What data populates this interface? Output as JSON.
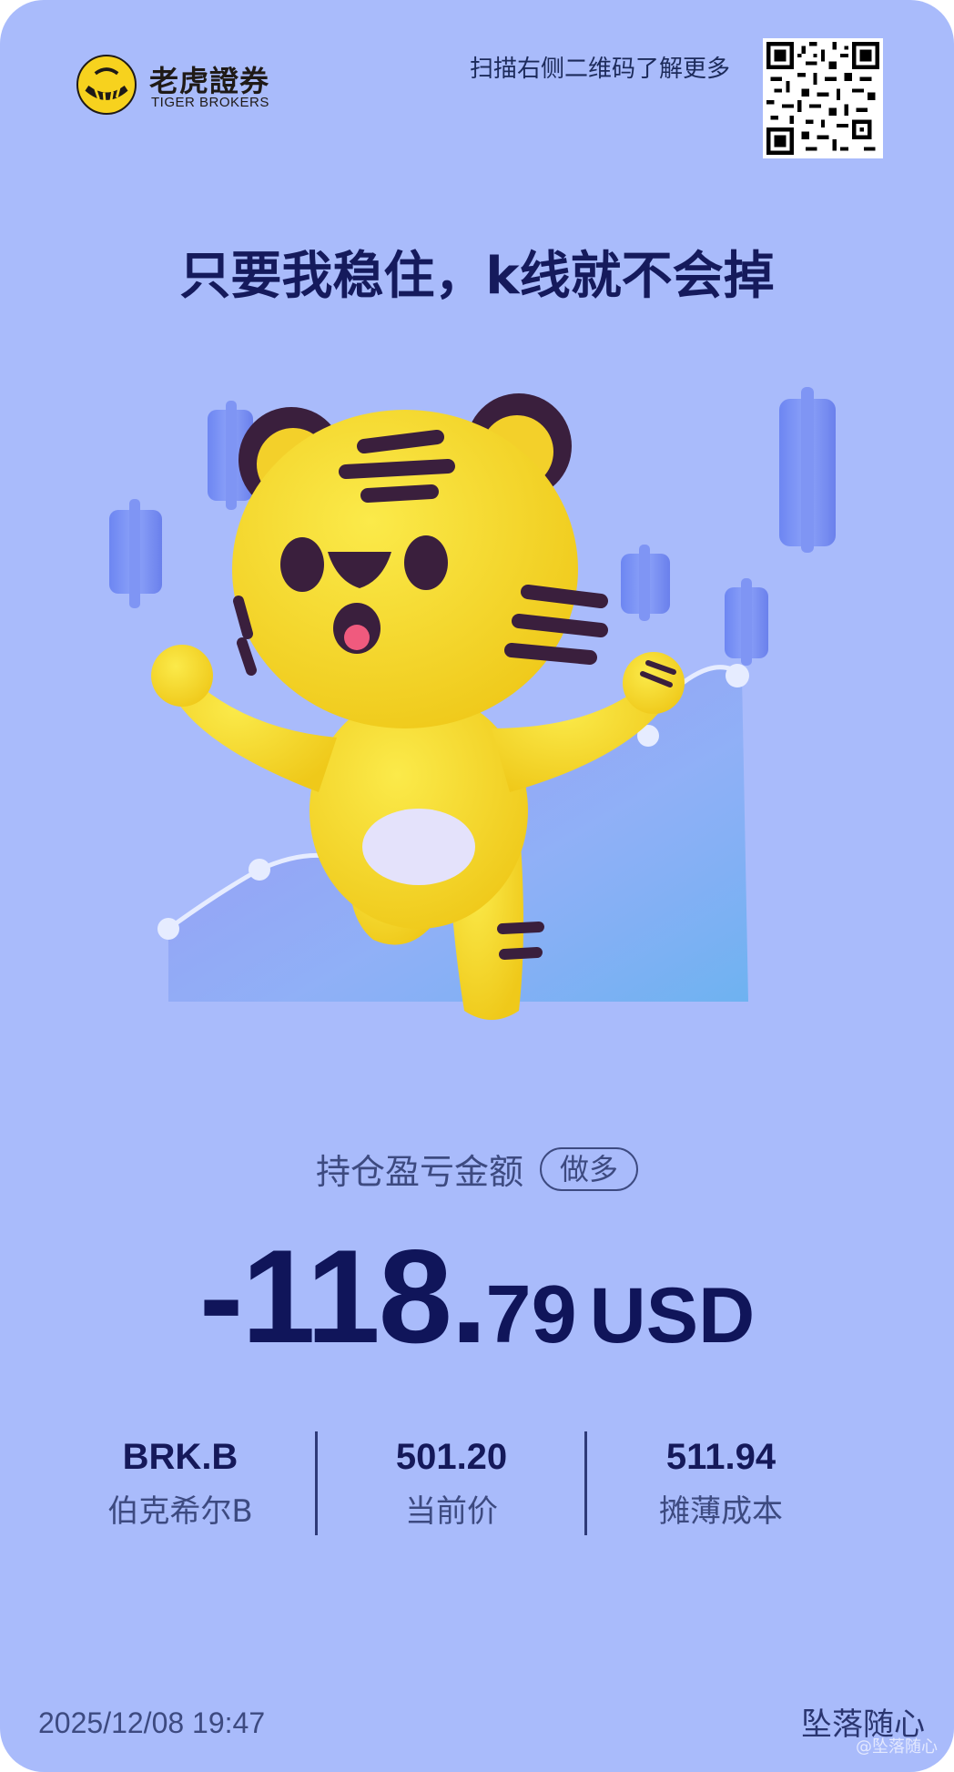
{
  "brand": {
    "name_cn": "老虎證券",
    "name_en": "TIGER BROKERS"
  },
  "header": {
    "scan_text": "扫描右侧二维码了解更多"
  },
  "headline": "只要我稳住，k线就不会掉",
  "position": {
    "pnl_label": "持仓盈亏金额",
    "direction": "做多",
    "pnl_integer": "-118.",
    "pnl_fraction": "79",
    "currency": "USD"
  },
  "stats": [
    {
      "value": "BRK.B",
      "label": "伯克希尔B"
    },
    {
      "value": "501.20",
      "label": "当前价"
    },
    {
      "value": "511.94",
      "label": "摊薄成本"
    }
  ],
  "footer": {
    "timestamp": "2025/12/08 19:47",
    "signature": "坠落随心",
    "watermark": "@坠落随心"
  },
  "colors": {
    "background": "#a9bbfb",
    "headline": "#151a5c",
    "pnl": "#10155a",
    "tiger_yellow": "#f7d21e"
  }
}
